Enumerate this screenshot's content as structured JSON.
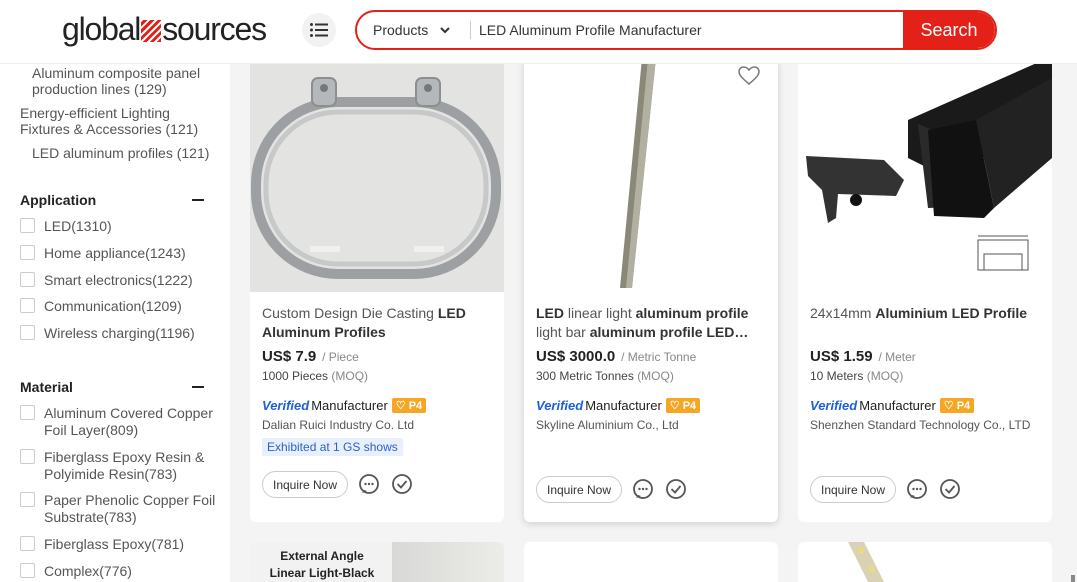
{
  "header": {
    "logo": {
      "left": "global",
      "right": "sources"
    },
    "search_category": "Products",
    "search_value": "LED Aluminum Profile Manufacturer",
    "search_button": "Search"
  },
  "sidebar": {
    "categories": [
      "Aluminum composite panel production lines (129)",
      "Energy-efficient Lighting Fixtures & Accessories (121)",
      "LED aluminum profiles (121)"
    ],
    "application": {
      "title": "Application",
      "items": [
        "LED(1310)",
        "Home appliance(1243)",
        "Smart electronics(1222)",
        "Communication(1209)",
        "Wireless charging(1196)"
      ]
    },
    "material": {
      "title": "Material",
      "items": [
        "Aluminum Covered Copper Foil Layer(809)",
        "Fiberglass Epoxy Resin & Polyimide Resin(783)",
        "Paper Phenolic Copper Foil Substrate(783)",
        "Fiberglass Epoxy(781)",
        "Complex(776)"
      ]
    }
  },
  "products": [
    {
      "title_parts": [
        [
          "Custom Design Die Casting ",
          false
        ],
        [
          "LED Aluminum Profiles",
          true
        ]
      ],
      "price": "US$ 7.9",
      "unit": "/ Piece",
      "moq_value": "1000 Pieces",
      "moq_label": "(MOQ)",
      "verified": "Verified",
      "manufacturer": "Manufacturer",
      "badge": "P4",
      "company": "Dalian Ruici Industry Co. Ltd",
      "exhibited": "Exhibited at 1 GS shows",
      "inquire": "Inquire Now"
    },
    {
      "title_parts": [
        [
          "LED",
          true
        ],
        [
          " linear light ",
          false
        ],
        [
          "aluminum profile",
          true
        ],
        [
          " light bar ",
          false
        ],
        [
          "aluminum profile LED…",
          true
        ]
      ],
      "price": "US$ 3000.0",
      "unit": "/ Metric Tonne",
      "moq_value": "300 Metric Tonnes",
      "moq_label": "(MOQ)",
      "verified": "Verified",
      "manufacturer": "Manufacturer",
      "badge": "P4",
      "company": "Skyline Aluminium Co., Ltd",
      "inquire": "Inquire Now"
    },
    {
      "title_parts": [
        [
          "24x14mm ",
          false
        ],
        [
          "Aluminium LED Profile",
          true
        ]
      ],
      "price": "US$ 1.59",
      "unit": "/ Meter",
      "moq_value": "10 Meters",
      "moq_label": "(MOQ)",
      "verified": "Verified",
      "manufacturer": "Manufacturer",
      "badge": "P4",
      "company": "Shenzhen Standard Technology Co., LTD",
      "inquire": "Inquire Now"
    }
  ],
  "next_row": {
    "first_image_text": "External Angle Linear Light-Black"
  },
  "colors": {
    "brand": "#e32118",
    "verified": "#1d5fd6",
    "badge": "#f6a623"
  }
}
